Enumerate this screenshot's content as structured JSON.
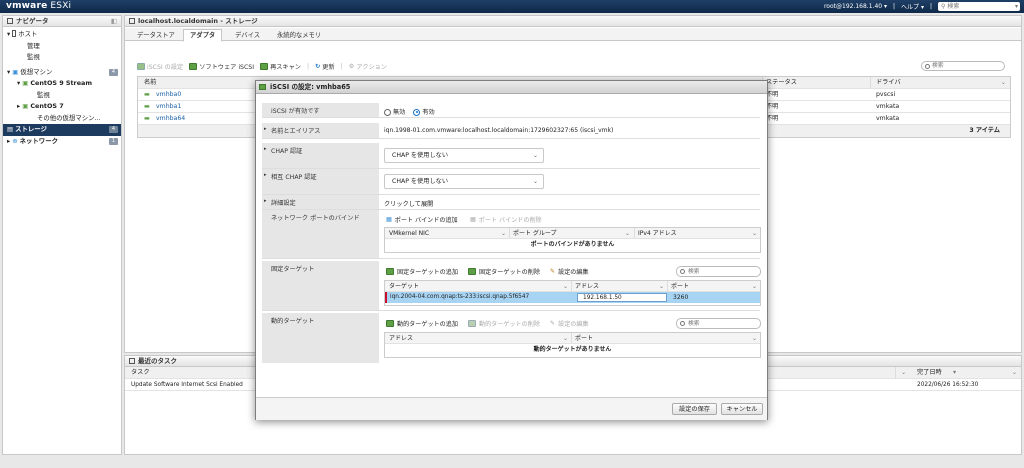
{
  "header": {
    "brand_vm": "vm",
    "brand_ware": "ware",
    "brand_product": "ESXi",
    "user": "root@192.168.1.40",
    "help": "ヘルプ",
    "search_placeholder": "検索"
  },
  "navigator": {
    "title": "ナビゲータ",
    "items": [
      {
        "label": "ホスト",
        "level": 0
      },
      {
        "label": "管理",
        "level": 2
      },
      {
        "label": "監視",
        "level": 2
      },
      {
        "label": "仮想マシン",
        "level": 0,
        "badge": "4"
      },
      {
        "label": "CentOS 9 Stream",
        "level": 1
      },
      {
        "label": "監視",
        "level": 2
      },
      {
        "label": "CentOS 7",
        "level": 1
      },
      {
        "label": "その他の仮想マシン...",
        "level": 2
      },
      {
        "label": "ストレージ",
        "level": 0,
        "badge": "4",
        "selected": true
      },
      {
        "label": "ネットワーク",
        "level": 0,
        "badge": "1"
      }
    ]
  },
  "main": {
    "title": "localhost.localdomain - ストレージ",
    "tabs": [
      "データストア",
      "アダプタ",
      "デバイス",
      "永続的なメモリ"
    ],
    "active_tab": "アダプタ",
    "toolbar": {
      "iscsi_config": "iSCSI の設定",
      "software_iscsi": "ソフトウェア iSCSI",
      "rescan": "再スキャン",
      "refresh": "更新",
      "actions": "アクション"
    },
    "search_placeholder": "検索",
    "grid": {
      "col_name": "名前",
      "col_status": "ステータス",
      "col_driver": "ドライバ",
      "rows": [
        {
          "name": "vmhba0",
          "status": "不明",
          "driver": "pvscsi"
        },
        {
          "name": "vmhba1",
          "status": "不明",
          "driver": "vmkata"
        },
        {
          "name": "vmhba64",
          "status": "不明",
          "driver": "vmkata"
        }
      ],
      "count": "3 アイテム"
    }
  },
  "tasks": {
    "title": "最近のタスク",
    "col_task": "タスク",
    "col_completed": "完了日時",
    "rows": [
      {
        "task": "Update Software Internet Scsi Enabled",
        "completed": "2022/06/26 16:52:30"
      }
    ]
  },
  "dialog": {
    "title": "iSCSI の設定: vmhba65",
    "iscsi_enabled_label": "iSCSI が有効です",
    "radio_disabled": "無効",
    "radio_enabled": "有効",
    "name_alias_label": "名前とエイリアス",
    "name_alias_value": "iqn.1998-01.com.vmware:localhost.localdomain:1729602327:65 (iscsi_vmk)",
    "chap_label": "CHAP 認証",
    "chap_value": "CHAP を使用しない",
    "mutual_chap_label": "相互 CHAP 認証",
    "mutual_chap_value": "CHAP を使用しない",
    "advanced_label": "詳細設定",
    "advanced_value": "クリックして展開",
    "port_binding_label": "ネットワーク ポートのバインド",
    "add_port_binding": "ポート バインドの追加",
    "remove_port_binding": "ポート バインドの削除",
    "port_cols": [
      "VMkernel NIC",
      "ポート グループ",
      "IPv4 アドレス"
    ],
    "port_empty": "ポートのバインドがありません",
    "static_label": "固定ターゲット",
    "add_static": "固定ターゲットの追加",
    "remove_static": "固定ターゲットの削除",
    "edit_settings": "設定の編集",
    "search_placeholder": "検索",
    "static_cols": [
      "ターゲット",
      "アドレス",
      "ポート"
    ],
    "static_rows": [
      {
        "target": "iqn.2004-04.com.qnap:ts-233:iscsi.qnap.5f6547",
        "address": "192.168.1.50",
        "port": "3260"
      }
    ],
    "dynamic_label": "動的ターゲット",
    "add_dynamic": "動的ターゲットの追加",
    "remove_dynamic": "動的ターゲットの削除",
    "dynamic_cols": [
      "アドレス",
      "ポート"
    ],
    "dynamic_empty": "動的ターゲットがありません",
    "save_button": "設定の保存",
    "cancel_button": "キャンセル"
  },
  "colors": {
    "topbar": "#15345a",
    "nav_selected": "#1d3a5f",
    "selected_row": "#a8d4f4",
    "accent_green": "#5fa046",
    "radio_blue": "#1a73c7",
    "error_red": "#c8102e"
  }
}
